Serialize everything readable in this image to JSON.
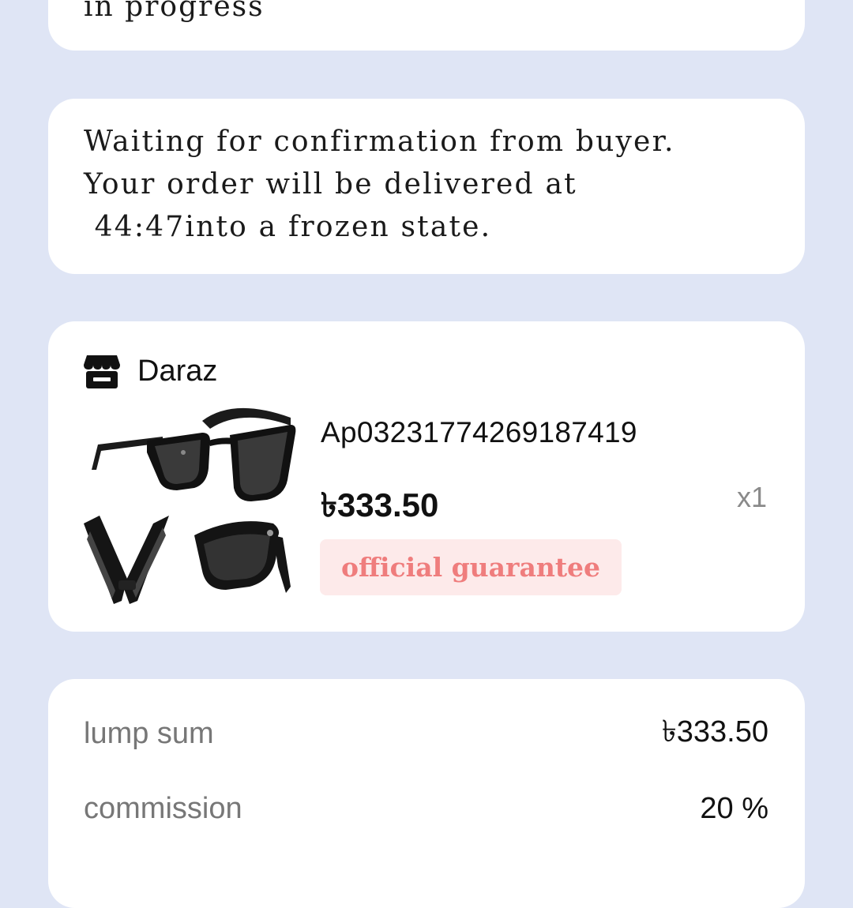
{
  "status_card": {
    "text": "in progress"
  },
  "waiting_card": {
    "lines": [
      "Waiting for confirmation from buyer.",
      "Your order will be delivered at",
      " 44:47into a frozen state."
    ]
  },
  "product_card": {
    "store_icon": "store-icon",
    "store_name": "Daraz",
    "product_image": "folding-sunglasses-image",
    "product_id": "Ap03231774269187419",
    "price": "৳333.50",
    "quantity": "x1",
    "badge": "official guarantee",
    "badge_color": "#ef7d7d",
    "badge_bg": "#fdeaea"
  },
  "summary_card": {
    "lump_sum_label": "lump sum",
    "lump_sum_value": "৳333.50",
    "commission_label": "commission",
    "commission_value": "20 %"
  },
  "colors": {
    "background": "#dfe5f5",
    "card": "#ffffff"
  }
}
